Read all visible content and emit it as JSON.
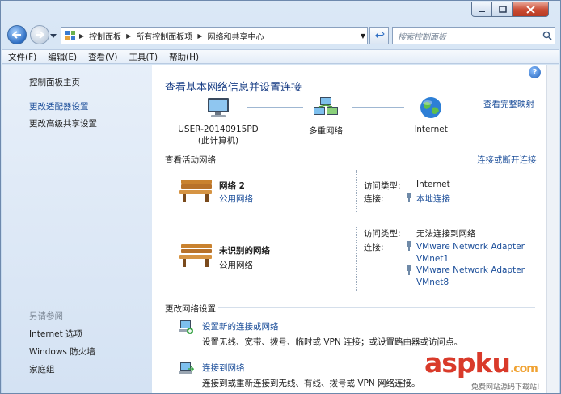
{
  "address": {
    "crumbs": [
      "控制面板",
      "所有控制面板项",
      "网络和共享中心"
    ]
  },
  "search": {
    "placeholder": "搜索控制面板"
  },
  "menu": [
    "文件(F)",
    "编辑(E)",
    "查看(V)",
    "工具(T)",
    "帮助(H)"
  ],
  "left_pane": {
    "home": "控制面板主页",
    "links": [
      "更改适配器设置",
      "更改高级共享设置"
    ],
    "see_also_title": "另请参阅",
    "see_also": [
      "Internet 选项",
      "Windows 防火墙",
      "家庭组"
    ]
  },
  "main": {
    "title": "查看基本网络信息并设置连接",
    "full_map": "查看完整映射",
    "nodes": [
      {
        "name": "USER-20140915PD",
        "sub": "(此计算机)"
      },
      {
        "name": "多重网络",
        "sub": ""
      },
      {
        "name": "Internet",
        "sub": ""
      }
    ],
    "active_title": "查看活动网络",
    "connect_link": "连接或断开连接",
    "networks": [
      {
        "name": "网络  2",
        "type": "公用网络",
        "access_label": "访问类型:",
        "access": "Internet",
        "conn_label": "连接:",
        "connections": [
          "本地连接"
        ]
      },
      {
        "name": "未识别的网络",
        "type": "公用网络",
        "access_label": "访问类型:",
        "access": "无法连接到网络",
        "conn_label": "连接:",
        "connections": [
          "VMware Network Adapter VMnet1",
          "VMware Network Adapter VMnet8"
        ]
      }
    ],
    "change_title": "更改网络设置",
    "settings": [
      {
        "link": "设置新的连接或网络",
        "desc": "设置无线、宽带、拨号、临时或 VPN 连接；或设置路由器或访问点。"
      },
      {
        "link": "连接到网络",
        "desc": "连接到或重新连接到无线、有线、拨号或 VPN 网络连接。"
      }
    ]
  },
  "watermark": {
    "brand": "aspku",
    "domain": ".com",
    "tagline": "免费网站源码下载站!"
  }
}
